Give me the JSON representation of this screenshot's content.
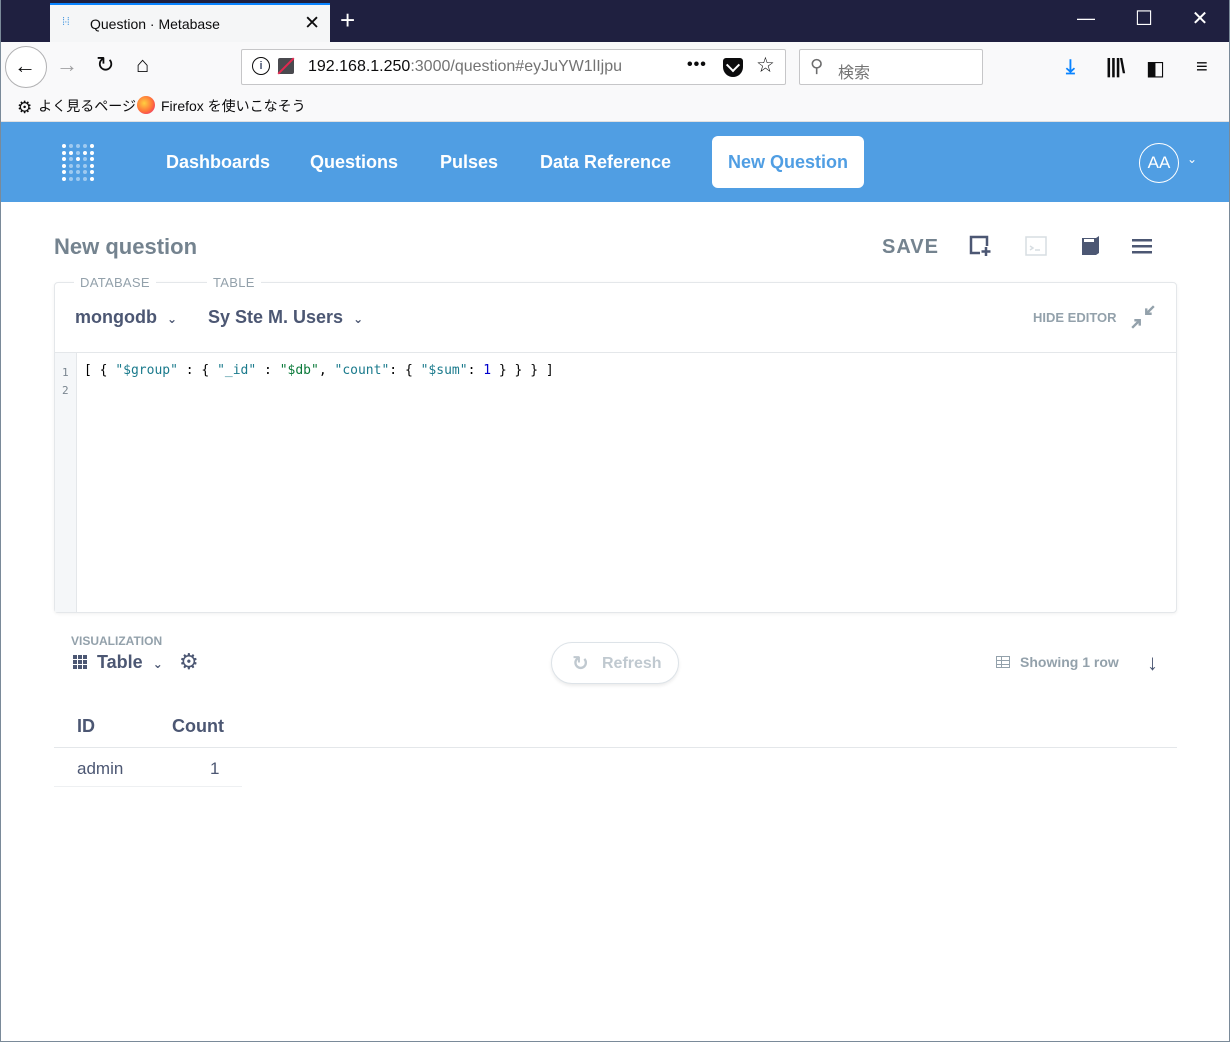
{
  "browser": {
    "tab_title": "Question · Metabase",
    "tab_favicon": "metabase-icon",
    "url_host": "192.168.1.250",
    "url_rest": ":3000/question#eyJuYW1lIjpu",
    "search_placeholder": "検索",
    "bookmarks": [
      {
        "label": "よく見るページ",
        "icon": "gear-icon"
      },
      {
        "label": "Firefox を使いこなそう",
        "icon": "firefox-icon"
      }
    ]
  },
  "nav": {
    "items": [
      "Dashboards",
      "Questions",
      "Pulses",
      "Data Reference"
    ],
    "new_question": "New Question",
    "avatar": "AA",
    "brand_color": "#509ee3"
  },
  "question": {
    "title": "New question",
    "save": "SAVE"
  },
  "editor": {
    "database_label": "DATABASE",
    "database_value": "mongodb",
    "table_label": "TABLE",
    "table_value": "Sy Ste M. Users",
    "hide_editor": "HIDE EDITOR",
    "line_numbers": [
      "1",
      "2"
    ],
    "code_tokens": [
      "[ { ",
      "\"$group\"",
      " : { ",
      "\"_id\"",
      " : ",
      "\"$db\"",
      ", ",
      "\"count\"",
      ": { ",
      "\"$sum\"",
      ": ",
      "1",
      " } } } ]"
    ]
  },
  "visualization": {
    "label": "VISUALIZATION",
    "type": "Table",
    "refresh": "Refresh",
    "row_count": "Showing 1 row"
  },
  "results": {
    "columns": [
      "ID",
      "Count"
    ],
    "rows": [
      [
        "admin",
        "1"
      ]
    ]
  }
}
